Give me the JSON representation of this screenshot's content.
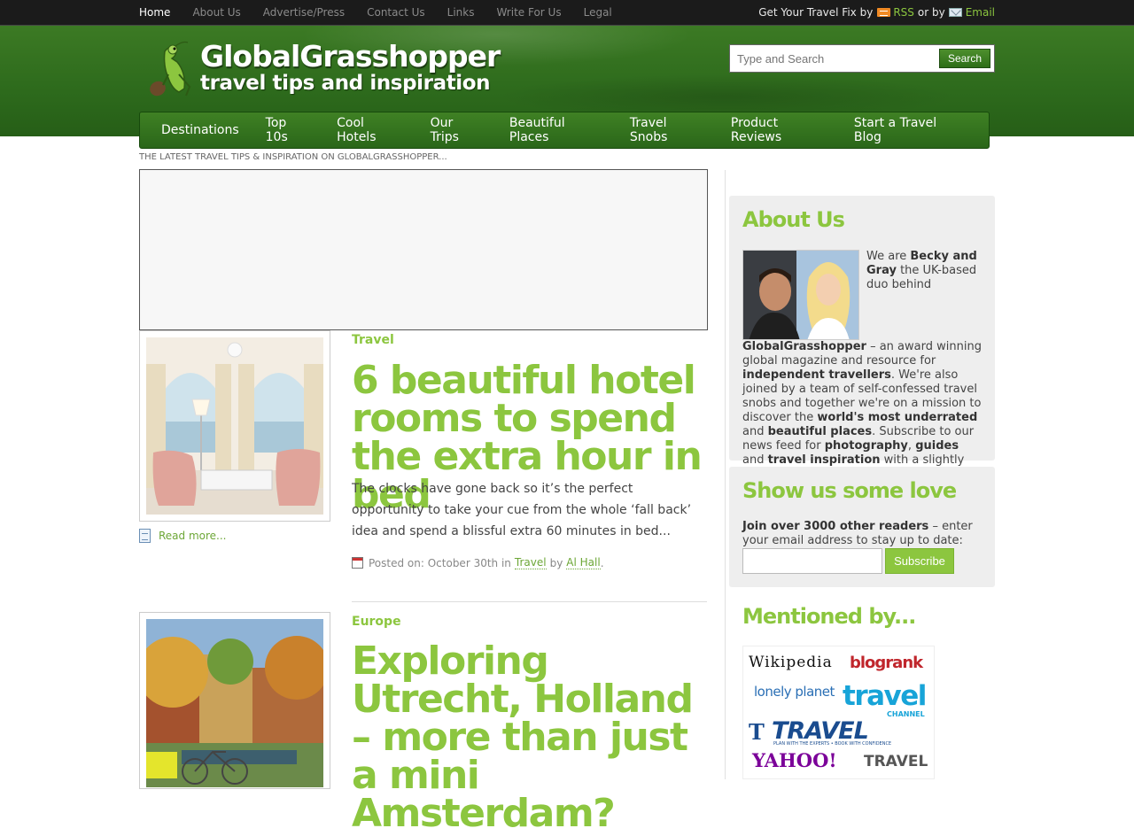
{
  "top_nav": {
    "items": [
      "Home",
      "About Us",
      "Advertise/Press",
      "Contact Us",
      "Links",
      "Write For Us",
      "Legal"
    ],
    "travel_fix_prefix": "Get Your Travel Fix by",
    "rss_label": "RSS",
    "or_by": "or by",
    "email_label": "Email"
  },
  "header": {
    "logo_title": "GlobalGrasshopper",
    "logo_tagline": "travel tips and inspiration",
    "search_placeholder": "Type and Search",
    "search_button": "Search"
  },
  "main_nav": {
    "items": [
      "Destinations",
      "Top 10s",
      "Cool Hotels",
      "Our Trips",
      "Beautiful Places",
      "Travel Snobs",
      "Product Reviews",
      "Start a Travel Blog"
    ]
  },
  "latest_label": "THE LATEST TRAVEL TIPS & INSPIRATION ON GLOBALGRASSHOPPER...",
  "posts": [
    {
      "category": "Travel",
      "title": "6 beautiful hotel rooms to spend the extra hour in bed",
      "excerpt": "The clocks have gone back so it’s the perfect opportunity to take your cue from the whole ‘fall back’ idea and spend a blissful extra 60 minutes in bed...",
      "read_more": "Read more...",
      "posted_on": "Posted on: October 30th in",
      "meta_category": "Travel",
      "by": "by",
      "author": "Al Hall",
      "end": "."
    },
    {
      "category": "Europe",
      "title": "Exploring Utrecht, Holland – more than just a mini Amsterdam?"
    }
  ],
  "sidebar": {
    "about": {
      "title": "About Us",
      "t1": "We are ",
      "b1": "Becky and Gray",
      "t2": " the UK-based duo behind ",
      "b2": "GlobalGrasshopper",
      "t3": " – an award winning global magazine and resource for ",
      "b3": "independent travellers",
      "t4": ". We're also joined by a team of self-confessed travel snobs and together we're on a mission to discover the ",
      "b4": "world's most underrated",
      "t5": " and ",
      "b5": "beautiful places",
      "t6": ". Subscribe to our news feed for ",
      "b6": "photography",
      "t7": ", ",
      "b7": "guides",
      "t8": " and ",
      "b8": "travel inspiration",
      "t9": " with a slightly off-beat outlook."
    },
    "love": {
      "title": "Show us some love",
      "bold": "Join over 3000 other readers",
      "text": " – enter your email address to stay up to date:",
      "button": "Subscribe"
    },
    "mentioned": {
      "title": "Mentioned by...",
      "logos": [
        "Wikipedia",
        "blogrank",
        "lonely planet",
        "travel",
        "CHANNEL",
        "TRAVEL",
        "PLAN WITH THE EXPERTS • BOOK WITH CONFIDENCE",
        "YAHOO!",
        "TRAVEL"
      ]
    }
  },
  "colors": {
    "accent": "#8cc63f",
    "header_green": "#2d6a1c",
    "topbar": "#1b1b1b"
  }
}
